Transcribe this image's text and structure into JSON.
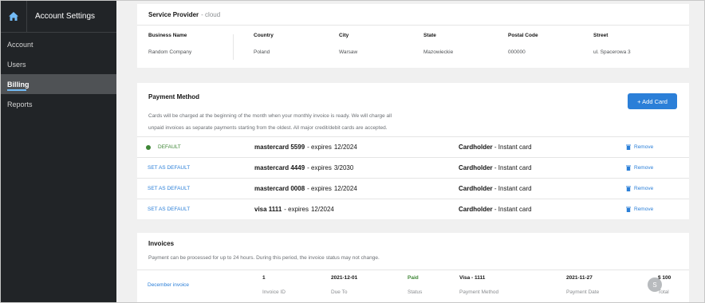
{
  "sidebar": {
    "title": "Account Settings",
    "home_icon": "home-icon",
    "items": [
      {
        "label": "Account"
      },
      {
        "label": "Users"
      },
      {
        "label": "Billing"
      },
      {
        "label": "Reports"
      }
    ],
    "active_item": "Billing"
  },
  "service_provider": {
    "title": "Service Provider",
    "subtitle": "- cloud",
    "columns": [
      {
        "label": "Business Name",
        "value": "Random Company"
      },
      {
        "label": "Country",
        "value": "Poland"
      },
      {
        "label": "City",
        "value": "Warsaw"
      },
      {
        "label": "State",
        "value": "Mazowieckie"
      },
      {
        "label": "Postal Code",
        "value": "000000"
      },
      {
        "label": "Street",
        "value": "ul. Spacerowa 3"
      }
    ]
  },
  "payment_method": {
    "title": "Payment Method",
    "description_line1": "Cards will be charged at the beginning of the month when your monthly invoice is ready. We will charge all",
    "description_line2": "unpaid invoices as separate payments starting from the oldest. All major credit/debit cards are accepted.",
    "add_card_label": "+ Add Card",
    "default_label": "DEFAULT",
    "set_default_label": "SET AS DEFAULT",
    "remove_label": "Remove",
    "cards": [
      {
        "status": "DEFAULT",
        "brand_number": "mastercard 5599",
        "expires_text": "- expires",
        "expiry": "12/2024",
        "holder": "Cardholder",
        "holder_detail": "- Instant card",
        "remove": "Remove"
      },
      {
        "status": "SET AS DEFAULT",
        "brand_number": "mastercard 4449",
        "expires_text": "- expires",
        "expiry": "3/2030",
        "holder": "Cardholder",
        "holder_detail": "- Instant card",
        "remove": "Remove"
      },
      {
        "status": "SET AS DEFAULT",
        "brand_number": "mastercard 0008",
        "expires_text": "- expires",
        "expiry": "12/2024",
        "holder": "Cardholder",
        "holder_detail": "- Instant card",
        "remove": "Remove"
      },
      {
        "status": "SET AS DEFAULT",
        "brand_number": "visa 1111",
        "expires_text": "- expires",
        "expiry": "12/2024",
        "holder": "Cardholder",
        "holder_detail": "- Instant card",
        "remove": "Remove"
      }
    ]
  },
  "invoices": {
    "title": "Invoices",
    "description": "Payment can be processed for up to 24 hours. During this period, the invoice status may not change.",
    "rows": [
      {
        "name": "December invoice",
        "cells": [
          {
            "value": "1",
            "label": "Invoice ID"
          },
          {
            "value": "2021-12-01",
            "label": "Due To"
          },
          {
            "value": "Paid",
            "label": "Status"
          },
          {
            "value": "Visa - 1111",
            "label": "Payment Method"
          },
          {
            "value": "2021-11-27",
            "label": "Payment Date"
          },
          {
            "value": "$ 100",
            "label": "Total"
          }
        ]
      }
    ]
  },
  "avatar_initial": "S",
  "colors": {
    "sidebar_bg": "#212427",
    "accent_blue": "#2b7fd8",
    "success_green": "#3e8635"
  }
}
